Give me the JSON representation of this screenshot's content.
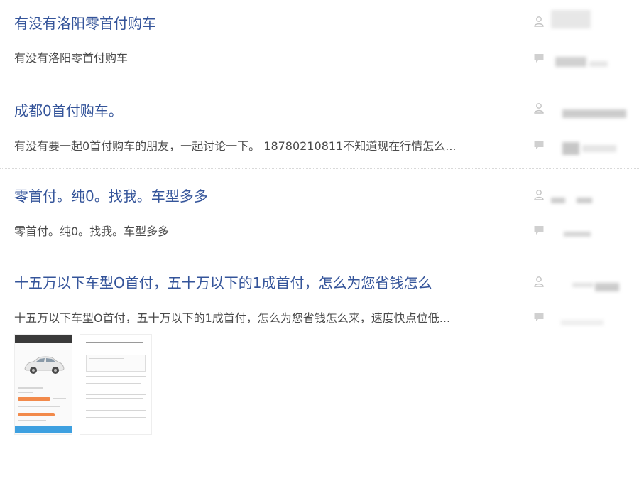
{
  "posts": [
    {
      "title": "有没有洛阳零首付购车",
      "excerpt": "有没有洛阳零首付购车"
    },
    {
      "title": "成都0首付购车。",
      "excerpt": "有没有要一起0首付购车的朋友，一起讨论一下。 18780210811不知道现在行情怎么..."
    },
    {
      "title": "零首付。纯0。找我。车型多多",
      "excerpt": "零首付。纯0。找我。车型多多"
    },
    {
      "title": "十五万以下车型O首付，五十万以下的1成首付，怎么为您省钱怎么",
      "excerpt": "十五万以下车型O首付，五十万以下的1成首付，怎么为您省钱怎么来，速度快点位低..."
    }
  ],
  "icons": {
    "author": "user-icon",
    "reply": "comment-icon"
  },
  "colors": {
    "title": "#34549a",
    "excerpt": "#4a4a4a",
    "icon": "#c4c4c4",
    "accent_orange": "#f28a4b",
    "accent_blue": "#3ea0e0"
  }
}
